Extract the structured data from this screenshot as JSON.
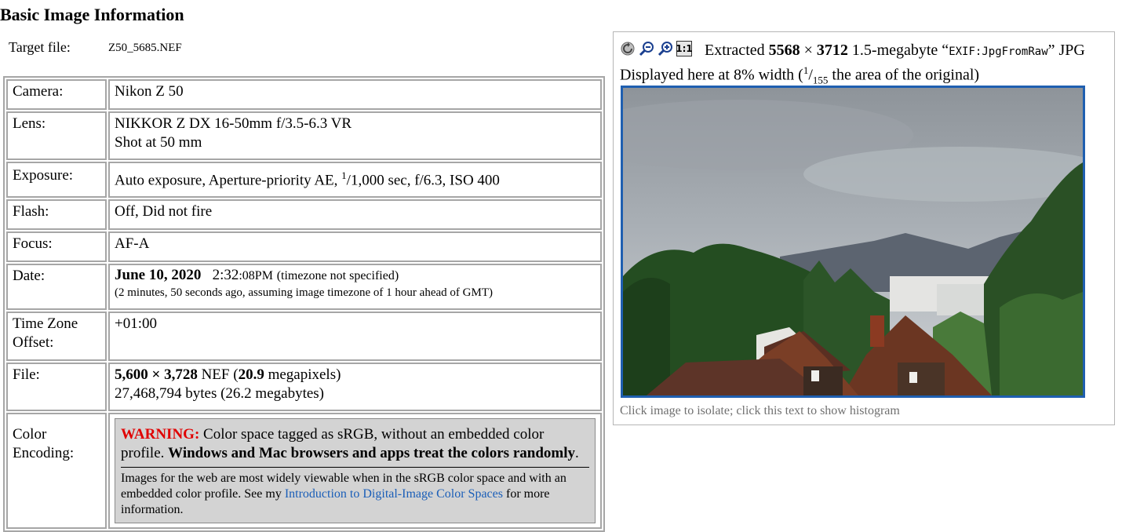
{
  "header": {
    "title": "Basic Image Information",
    "target_label": "Target file:",
    "target_value": "Z50_5685.NEF"
  },
  "rows": {
    "camera": {
      "label": "Camera:",
      "value": "Nikon Z 50"
    },
    "lens": {
      "label": "Lens:",
      "line1": "NIKKOR Z DX 16-50mm f/3.5-6.3 VR",
      "line2": "Shot at 50 mm"
    },
    "exposure": {
      "label": "Exposure:",
      "prefix": "Auto exposure, Aperture-priority AE, ",
      "num": "1",
      "den": "1,000 sec",
      "suffix": ", f/6.3, ISO 400"
    },
    "flash": {
      "label": "Flash:",
      "value": "Off, Did not fire"
    },
    "focus": {
      "label": "Focus:",
      "value": "AF-A"
    },
    "date": {
      "label": "Date:",
      "date_bold": "June 10, 2020",
      "time_main": "2:32",
      "time_sec": ":08PM",
      "tz_note": "(timezone not specified)",
      "ago": "(2 minutes, 50 seconds ago, assuming image timezone of 1 hour ahead of GMT)"
    },
    "tz": {
      "label": "Time Zone Offset:",
      "value": "+01:00"
    },
    "file": {
      "label": "File:",
      "dims": "5,600 × 3,728",
      "format": " NEF (",
      "mp": "20.9",
      "mp_suffix": " megapixels)",
      "bytes": "27,468,794 bytes (26.2 megabytes)"
    },
    "color": {
      "label": "Color Encoding:",
      "warning_label": "WARNING:",
      "warning_text": " Color space tagged as sRGB, without an embedded color profile. ",
      "warning_bold": "Windows and Mac browsers and apps treat the colors randomly",
      "warning_end": ".",
      "note_pre": "Images for the web are most widely viewable when in the sRGB color space and with an embedded color profile. See my ",
      "note_link": "Introduction to Digital-Image Color Spaces",
      "note_post": " for more information."
    }
  },
  "preview": {
    "icons": [
      "reload-icon",
      "zoom-out-icon",
      "zoom-in-icon",
      "actual-size-icon"
    ],
    "actual_size_label": "1:1",
    "extracted_pre": "Extracted ",
    "extracted_w": "5568",
    "times": " × ",
    "extracted_h": "3712",
    "extracted_mid": " 1.5-megabyte “",
    "extracted_tag": "EXIF:JpgFromRaw",
    "extracted_post": "” JPG",
    "displayed_pre": "Displayed here at 8% width (",
    "frac_num": "1",
    "frac_den": "155",
    "displayed_post": " the area of the original)",
    "caption": "Click image to isolate; click this text to show histogram"
  },
  "colors": {
    "warning": "#e00000",
    "link": "#1a5eb8",
    "frame": "#1f5fb0",
    "border": "#a6a6a6"
  }
}
